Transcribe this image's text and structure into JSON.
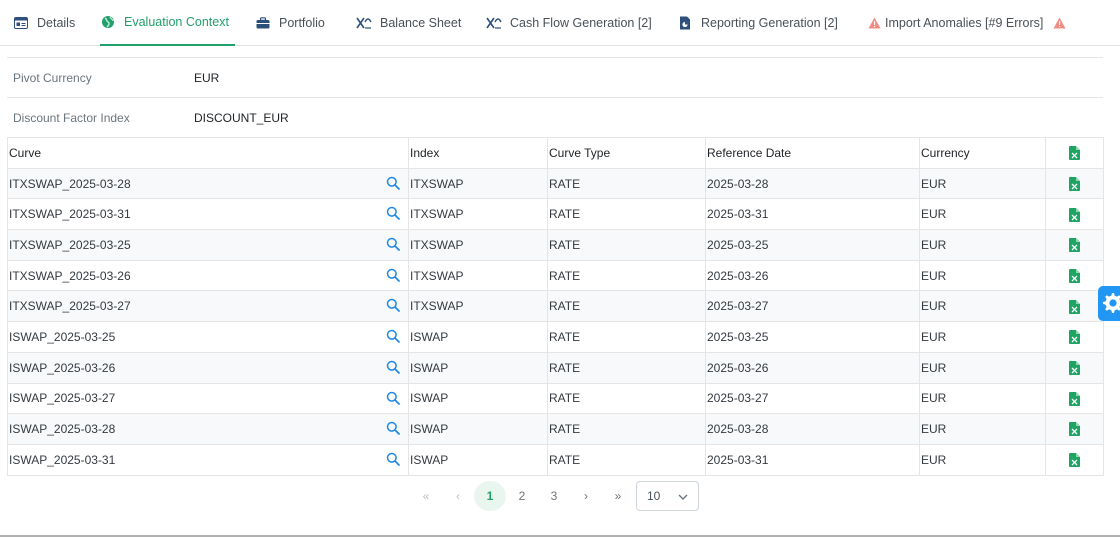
{
  "tabs": [
    {
      "label": "Details",
      "icon": "id-card-icon",
      "active": false
    },
    {
      "label": "Evaluation Context",
      "icon": "globe-icon",
      "active": true
    },
    {
      "label": "Portfolio",
      "icon": "briefcase-icon",
      "active": false
    },
    {
      "label": "Balance Sheet",
      "icon": "chart-cross-icon",
      "active": false
    },
    {
      "label": "Cash Flow Generation [2]",
      "icon": "chart-cross-icon",
      "active": false
    },
    {
      "label": "Reporting Generation [2]",
      "icon": "report-file-icon",
      "active": false
    },
    {
      "label": "Import Anomalies [#9 Errors]",
      "icon": "warning-icon",
      "active": false
    }
  ],
  "context": {
    "pivot_currency_label": "Pivot Currency",
    "pivot_currency_value": "EUR",
    "discount_index_label": "Discount Factor Index",
    "discount_index_value": "DISCOUNT_EUR"
  },
  "table": {
    "headers": {
      "curve": "Curve",
      "index": "Index",
      "curve_type": "Curve Type",
      "reference_date": "Reference Date",
      "currency": "Currency"
    },
    "rows": [
      {
        "curve": "ITXSWAP_2025-03-28",
        "index": "ITXSWAP",
        "curve_type": "RATE",
        "reference_date": "2025-03-28",
        "currency": "EUR"
      },
      {
        "curve": "ITXSWAP_2025-03-31",
        "index": "ITXSWAP",
        "curve_type": "RATE",
        "reference_date": "2025-03-31",
        "currency": "EUR"
      },
      {
        "curve": "ITXSWAP_2025-03-25",
        "index": "ITXSWAP",
        "curve_type": "RATE",
        "reference_date": "2025-03-25",
        "currency": "EUR"
      },
      {
        "curve": "ITXSWAP_2025-03-26",
        "index": "ITXSWAP",
        "curve_type": "RATE",
        "reference_date": "2025-03-26",
        "currency": "EUR"
      },
      {
        "curve": "ITXSWAP_2025-03-27",
        "index": "ITXSWAP",
        "curve_type": "RATE",
        "reference_date": "2025-03-27",
        "currency": "EUR"
      },
      {
        "curve": "ISWAP_2025-03-25",
        "index": "ISWAP",
        "curve_type": "RATE",
        "reference_date": "2025-03-25",
        "currency": "EUR"
      },
      {
        "curve": "ISWAP_2025-03-26",
        "index": "ISWAP",
        "curve_type": "RATE",
        "reference_date": "2025-03-26",
        "currency": "EUR"
      },
      {
        "curve": "ISWAP_2025-03-27",
        "index": "ISWAP",
        "curve_type": "RATE",
        "reference_date": "2025-03-27",
        "currency": "EUR"
      },
      {
        "curve": "ISWAP_2025-03-28",
        "index": "ISWAP",
        "curve_type": "RATE",
        "reference_date": "2025-03-28",
        "currency": "EUR"
      },
      {
        "curve": "ISWAP_2025-03-31",
        "index": "ISWAP",
        "curve_type": "RATE",
        "reference_date": "2025-03-31",
        "currency": "EUR"
      }
    ]
  },
  "pagination": {
    "first": "«",
    "prev": "‹",
    "pages": [
      "1",
      "2",
      "3"
    ],
    "current_page": "1",
    "next": "›",
    "last": "»",
    "rows_per_page": "10"
  },
  "colors": {
    "accent": "#22a06b",
    "excel": "#1fa463",
    "search": "#1e88e5",
    "warning": "#f28b82",
    "settings_tab": "#2196f3"
  }
}
